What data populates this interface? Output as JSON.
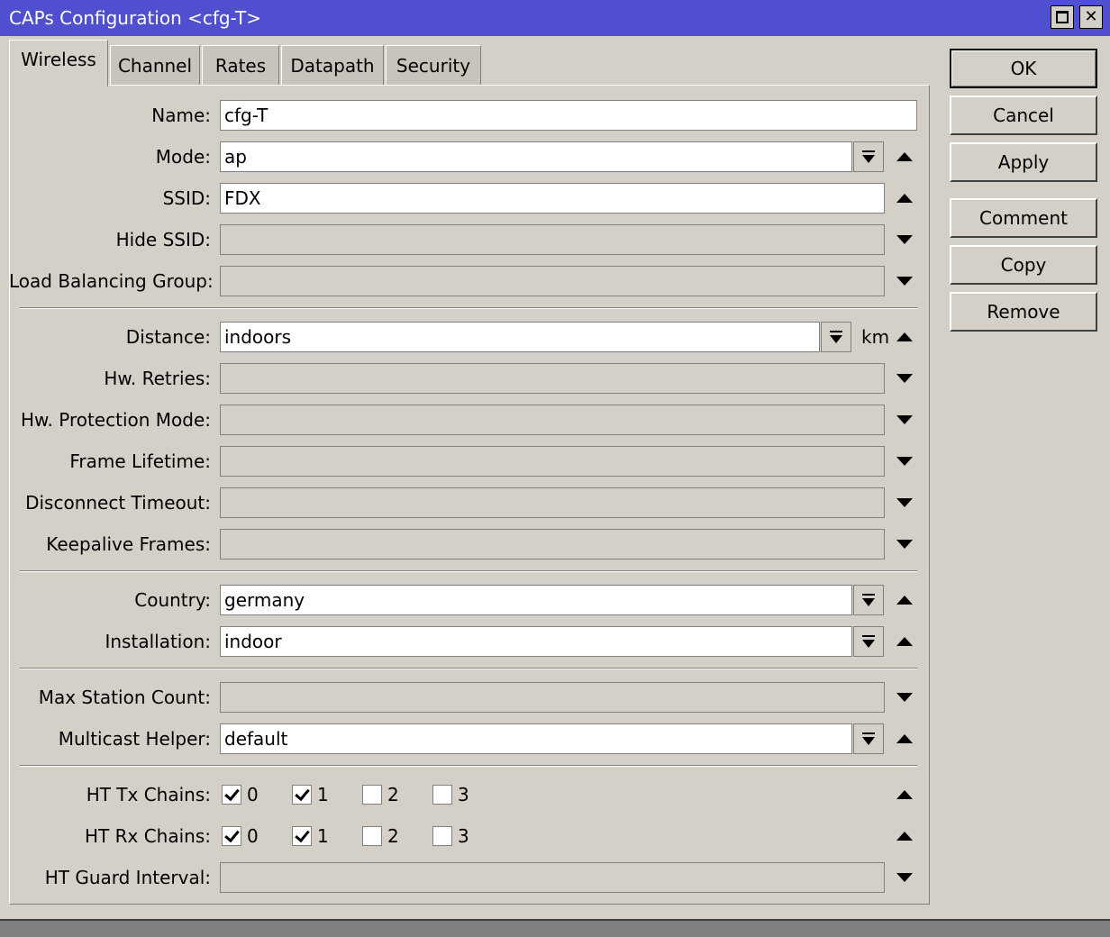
{
  "window": {
    "title": "CAPs Configuration <cfg-T>"
  },
  "tabs": [
    {
      "label": "Wireless",
      "active": true
    },
    {
      "label": "Channel"
    },
    {
      "label": "Rates"
    },
    {
      "label": "Datapath"
    },
    {
      "label": "Security"
    }
  ],
  "fields": {
    "name": {
      "label": "Name:",
      "value": "cfg-T"
    },
    "mode": {
      "label": "Mode:",
      "value": "ap"
    },
    "ssid": {
      "label": "SSID:",
      "value": "FDX"
    },
    "hide_ssid": {
      "label": "Hide SSID:",
      "value": ""
    },
    "load_balancing_group": {
      "label": "Load Balancing Group:",
      "value": ""
    },
    "distance": {
      "label": "Distance:",
      "value": "indoors",
      "unit": "km"
    },
    "hw_retries": {
      "label": "Hw. Retries:",
      "value": ""
    },
    "hw_protection_mode": {
      "label": "Hw. Protection Mode:",
      "value": ""
    },
    "frame_lifetime": {
      "label": "Frame Lifetime:",
      "value": ""
    },
    "disconnect_timeout": {
      "label": "Disconnect Timeout:",
      "value": ""
    },
    "keepalive_frames": {
      "label": "Keepalive Frames:",
      "value": ""
    },
    "country": {
      "label": "Country:",
      "value": "germany"
    },
    "installation": {
      "label": "Installation:",
      "value": "indoor"
    },
    "max_station_count": {
      "label": "Max Station Count:",
      "value": ""
    },
    "multicast_helper": {
      "label": "Multicast Helper:",
      "value": "default"
    },
    "ht_tx_chains": {
      "label": "HT Tx Chains:",
      "options": [
        {
          "label": "0",
          "checked": true
        },
        {
          "label": "1",
          "checked": true
        },
        {
          "label": "2",
          "checked": false
        },
        {
          "label": "3",
          "checked": false
        }
      ]
    },
    "ht_rx_chains": {
      "label": "HT Rx Chains:",
      "options": [
        {
          "label": "0",
          "checked": true
        },
        {
          "label": "1",
          "checked": true
        },
        {
          "label": "2",
          "checked": false
        },
        {
          "label": "3",
          "checked": false
        }
      ]
    },
    "ht_guard_interval": {
      "label": "HT Guard Interval:",
      "value": ""
    }
  },
  "buttons": {
    "ok": "OK",
    "cancel": "Cancel",
    "apply": "Apply",
    "comment": "Comment",
    "copy": "Copy",
    "remove": "Remove"
  },
  "colors": {
    "titlebar": "#4f4fcf",
    "window_bg": "#d4d0c8"
  }
}
